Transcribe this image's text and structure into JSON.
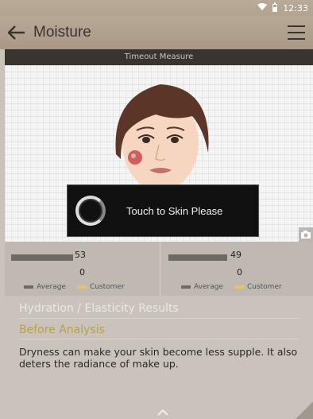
{
  "status_bar": {
    "time": "12:33",
    "wifi_icon": "wifi-icon",
    "battery_icon": "battery-icon"
  },
  "app_bar": {
    "back_icon": "arrow-left-icon",
    "title": "Moisture",
    "menu_icon": "menu-icon"
  },
  "subheader": "Timeout Measure",
  "dialog": {
    "message": "Touch to Skin Please"
  },
  "camera_icon": "camera-icon",
  "stats": {
    "left": {
      "bar1_value": "53",
      "bar2_value": "0",
      "legend_average": "Average",
      "legend_customer": "Customer"
    },
    "right": {
      "bar1_value": "49",
      "bar2_value": "0",
      "legend_average": "Average",
      "legend_customer": "Customer"
    },
    "average_color": "#6f6964",
    "customer_color": "#e3c46a"
  },
  "results": {
    "title": "Hydration / Elasticity Results",
    "subtitle": "Before Analysis",
    "body": "Dryness can make your skin become less supple. It also deters the radiance of make up."
  }
}
